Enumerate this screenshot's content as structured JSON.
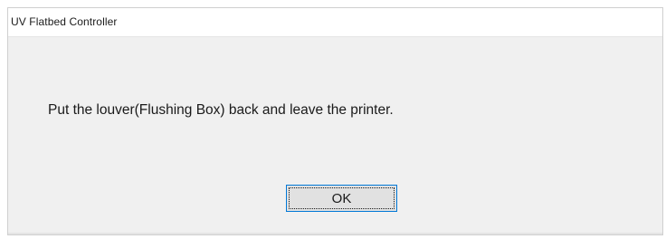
{
  "window": {
    "title": "UV Flatbed Controller"
  },
  "dialog": {
    "message": "Put the louver(Flushing Box) back and leave the printer.",
    "ok_label": "OK"
  },
  "colors": {
    "dialog_background": "#f0f0f0",
    "titlebar_background": "#ffffff",
    "button_focus_border": "#0078d7"
  }
}
